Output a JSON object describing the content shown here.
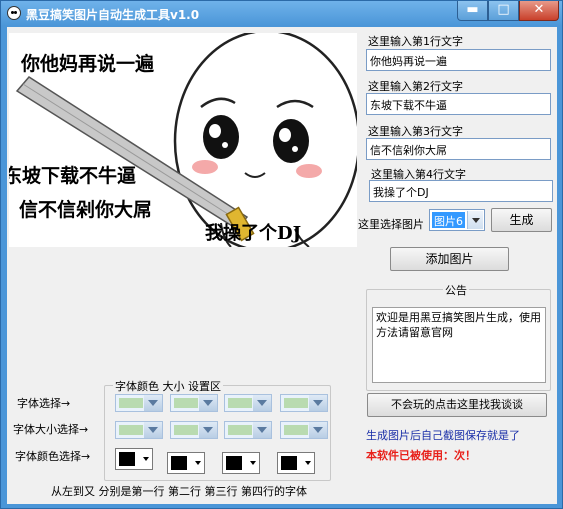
{
  "window": {
    "title": "黑豆搞笑图片自动生成工具v1.0",
    "controls": {
      "minimize": "▬",
      "maximize": "□",
      "close": "✕"
    }
  },
  "meme": {
    "line1": "你他妈再说一遍",
    "line2": "东坡下载不牛逼",
    "line3": "信不信剁你大屌",
    "line4": "我操了个DJ"
  },
  "inputs": [
    {
      "prompt": "这里输入第1行文字",
      "value": "你他妈再说一遍"
    },
    {
      "prompt": "这里输入第2行文字",
      "value": "东坡下载不牛逼"
    },
    {
      "prompt": "这里输入第3行文字",
      "value": "信不信剁你大屌"
    },
    {
      "prompt": "这里输入第4行文字",
      "value": "我操了个DJ"
    }
  ],
  "image_select": {
    "label": "这里选择图片",
    "value": "图片6"
  },
  "buttons": {
    "generate": "生成",
    "add_image": "添加图片",
    "contact": "不会玩的点击这里找我谈谈"
  },
  "notice": {
    "title": "公告",
    "text": "欢迎是用黑豆搞笑图片生成，使用方法请留意官网"
  },
  "info": {
    "tip": "生成图片后自己截图保存就是了",
    "usage": "本软件已被使用：次！"
  },
  "font_settings": {
    "group_title": "字体颜色 大小 设置区",
    "row_font": "字体选择→",
    "row_size": "字体大小选择→",
    "row_color": "字体颜色选择→",
    "footer": "从左到又 分别是第一行 第二行 第三行 第四行的字体"
  },
  "colors": {
    "title_bar": "#4b96d8",
    "close_button": "#c9402b",
    "selection": "#3399ff",
    "info_blue": "#1a2fa8",
    "info_red": "#e8201a",
    "swatch": "#000000"
  }
}
